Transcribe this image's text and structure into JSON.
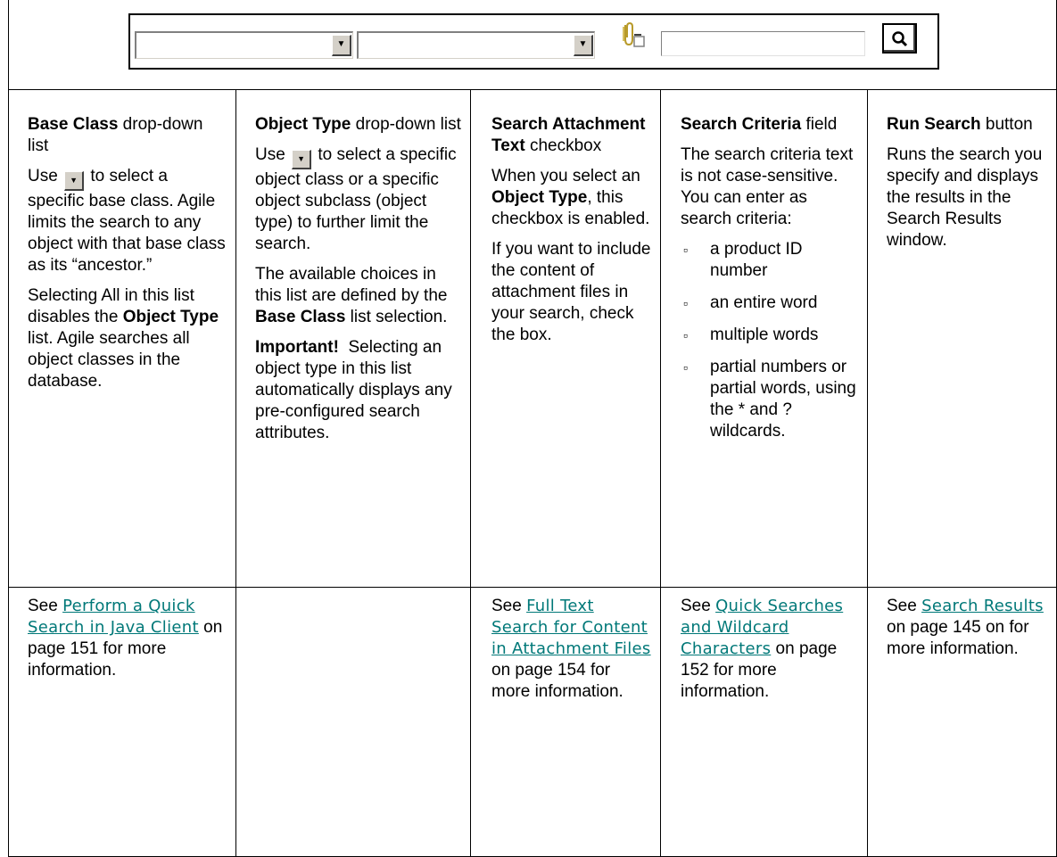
{
  "icons": {
    "dropdown_arrow": "down-arrow-icon",
    "attachment": "paperclip-checkbox-icon",
    "search": "magnifier-icon"
  },
  "columns": [
    {
      "heading_bold": "Base Class",
      "heading_rest": " drop-down list",
      "use_prefix": "Use ",
      "use_suffix": " to select a specific base class. Agile limits the search to any object with that base class as its “ancestor.”",
      "p2_a": "Selecting All in this list disables the ",
      "p2_b": "Object Type",
      "p2_c": " list. Agile searches all object classes in the database.",
      "ref_prefix": "See ",
      "ref_link": "Perform a Quick Search in Java Client",
      "ref_suffix": " on page 151 for more information."
    },
    {
      "heading_bold": "Object Type",
      "heading_rest": " drop-down list",
      "use_prefix": "Use ",
      "use_suffix": " to select a specific object class or a specific object subclass (object type) to further limit the search.",
      "p2_a": "The available choices in this list are defined by the ",
      "p2_b": "Base Class",
      "p2_c": " list selection.",
      "p3_bold": "Important!",
      "p3_rest": "  Selecting an object type in this list automatically displays any pre-configured search attributes."
    },
    {
      "heading_bold": "Search Attachment Text",
      "heading_rest": " checkbox",
      "p1_a": "When you select an ",
      "p1_b": "Object Type",
      "p1_c": ", this checkbox is enabled.",
      "p2": "If you want to include the content of attachment files in your search, check the box.",
      "ref_prefix": "See ",
      "ref_link": "Full Text Search for Content in Attachment Files",
      "ref_suffix": " on page 154 for more information."
    },
    {
      "heading_bold": "Search Criteria",
      "heading_rest": " field",
      "p1": "The search criteria text is not case-sensitive. You can enter as search criteria:",
      "bullet_char": "▫",
      "bullets": [
        "a product ID number",
        "an entire word",
        "multiple words",
        "partial numbers or partial words, using the * and ? wildcards."
      ],
      "ref_prefix": "See ",
      "ref_link": "Quick Searches and Wildcard Characters",
      "ref_suffix": " on page 152 for more information."
    },
    {
      "heading_bold": "Run Search",
      "heading_rest": " button",
      "p1": "Runs the search you specify and displays the results in the Search Results window.",
      "ref_prefix": "See ",
      "ref_link": "Search Results",
      "ref_suffix": " on page 145 on for more information."
    }
  ]
}
